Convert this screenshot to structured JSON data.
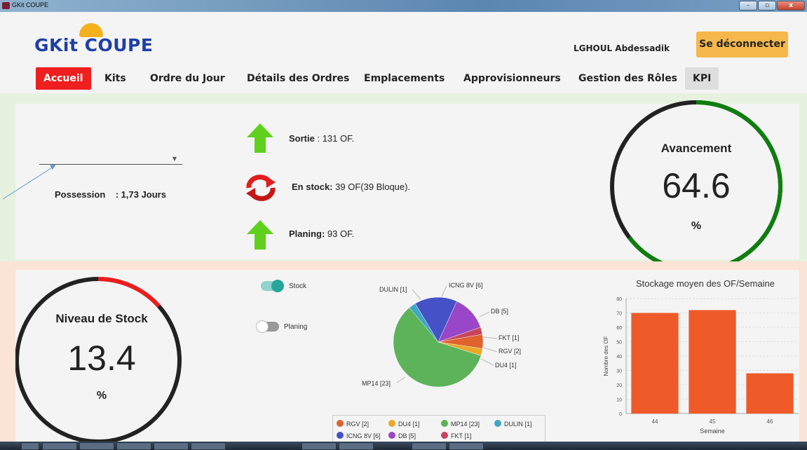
{
  "window": {
    "title": "GKit COUPE",
    "minimize": "–",
    "maximize": "▫",
    "close": "x"
  },
  "header": {
    "logo": "GKit COUPE",
    "user_name": "LGHOUL Abdessadik",
    "logout_label": "Se déconnecter"
  },
  "nav": [
    {
      "label": "Accueil",
      "active": true
    },
    {
      "label": "Kits"
    },
    {
      "label": "Ordre du Jour"
    },
    {
      "label": "Détails des Ordres"
    },
    {
      "label": "Emplacements"
    },
    {
      "label": "Approvisionneurs"
    },
    {
      "label": "Gestion des Rôles"
    },
    {
      "label": "KPI"
    }
  ],
  "kpi_top": {
    "week_select_value": "",
    "possession_label": "Possession",
    "possession_value": ": 1,73 Jours",
    "sortie_label": "Sortie",
    "sortie_value": ":  131 OF.",
    "stock_label": "En stock:",
    "stock_value": "39 OF(39 Bloque).",
    "planing_label": "Planing:",
    "planing_value": "93 OF.",
    "avancement": {
      "title": "Avancement",
      "value": "64.6",
      "unit": "%",
      "fraction": 0.646
    }
  },
  "kpi_bottom": {
    "niveau_stock": {
      "title": "Niveau de Stock",
      "value": "13.4",
      "unit": "%",
      "fraction": 0.134
    },
    "toggles": [
      {
        "label": "Stock",
        "on": true
      },
      {
        "label": "Planing",
        "on": false
      }
    ]
  },
  "pie": {
    "slices": [
      {
        "name": "RGV",
        "value": 2,
        "label": "RGV [2]",
        "color": "#e0622d"
      },
      {
        "name": "DU4",
        "value": 1,
        "label": "DU4 [1]",
        "color": "#eba726"
      },
      {
        "name": "MP14",
        "value": 23,
        "label": "MP14 [23]",
        "color": "#5cb35a"
      },
      {
        "name": "DULIN",
        "value": 1,
        "label": "DULIN [1]",
        "color": "#3fa7c6"
      },
      {
        "name": "ICNG 8V",
        "value": 6,
        "label": "ICNG 8V [6]",
        "color": "#4452c6"
      },
      {
        "name": "DB",
        "value": 5,
        "label": "DB [5]",
        "color": "#9a46c9"
      },
      {
        "name": "FKT",
        "value": 1,
        "label": "FKT [1]",
        "color": "#c6455d"
      }
    ]
  },
  "chart_data": {
    "type": "bar",
    "title": "Stockage moyen des OF/Semaine",
    "xlabel": "Semaine",
    "ylabel": "Nombre des OF",
    "categories": [
      "44",
      "45",
      "46"
    ],
    "values": [
      70,
      72,
      28
    ],
    "ylim": [
      0,
      80
    ],
    "yticks": [
      "0",
      "10",
      "20",
      "30",
      "40",
      "50",
      "60",
      "70",
      "80"
    ],
    "bar_color": "#ef5a28",
    "grid": true
  },
  "colors": {
    "green_arrow": "#5fd11d",
    "gauge_green": "#0e7e0e",
    "gauge_red": "#ee1c1c",
    "gauge_dark": "#222222",
    "toggle_on": "#26a69a"
  }
}
